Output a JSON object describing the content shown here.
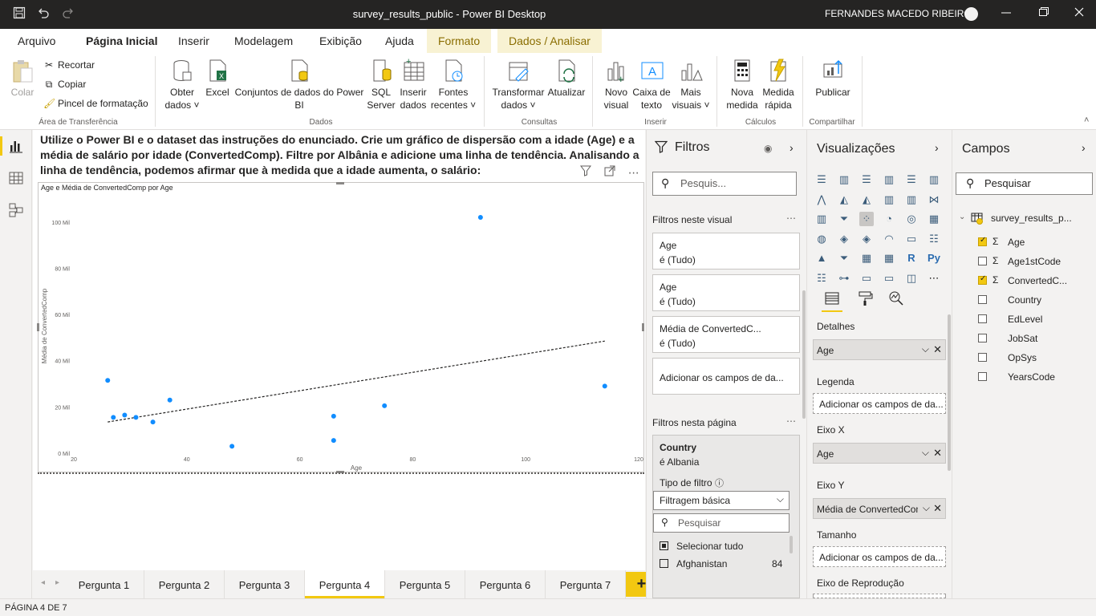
{
  "window": {
    "title": "survey_results_public - Power BI Desktop",
    "user": "FERNANDES MACEDO RIBEIRO"
  },
  "icons": {
    "save": "save-icon",
    "undo": "undo-icon",
    "redo": "redo-icon",
    "minimize": "minimize-icon",
    "maximize": "maximize-icon",
    "close": "close-icon"
  },
  "tabs": [
    "Arquivo",
    "Página Inicial",
    "Inserir",
    "Modelagem",
    "Exibição",
    "Ajuda",
    "Formato",
    "Dados / Analisar"
  ],
  "ribbon": {
    "clipboard": {
      "paste": "Colar",
      "cut": "Recortar",
      "copy": "Copiar",
      "painter": "Pincel de formatação",
      "group": "Área de Transferência"
    },
    "data": {
      "get1": "Obter",
      "get2": "dados",
      "excel": "Excel",
      "datasets1": "Conjuntos de dados do Power",
      "datasets2": "BI",
      "sql1": "SQL",
      "sql2": "Server",
      "enter1": "Inserir",
      "enter2": "dados",
      "sources1": "Fontes",
      "sources2": "recentes",
      "group": "Dados"
    },
    "queries": {
      "transform1": "Transformar",
      "transform2": "dados",
      "refresh": "Atualizar",
      "group": "Consultas"
    },
    "insert": {
      "visual1": "Novo",
      "visual2": "visual",
      "text1": "Caixa de",
      "text2": "texto",
      "more1": "Mais",
      "more2": "visuais",
      "group": "Inserir"
    },
    "calc": {
      "measure1": "Nova",
      "measure2": "medida",
      "quick1": "Medida",
      "quick2": "rápida",
      "group": "Cálculos"
    },
    "share": {
      "publish": "Publicar",
      "group": "Compartilhar"
    }
  },
  "question": "Utilize o Power BI e o dataset das instruções do enunciado. Crie um gráfico de dispersão com a idade (Age) e a média de salário por idade (ConvertedComp). Filtre por Albânia e adicione uma linha de tendência. Analisando a linha de tendência, podemos afirmar que à medida que a idade aumenta, o salário:",
  "chart_data": {
    "type": "scatter",
    "title": "Age e Média de ConvertedComp por Age",
    "xlabel": "Age",
    "ylabel": "Média de ConvertedComp",
    "xlim": [
      20,
      120
    ],
    "ylim": [
      0,
      110000
    ],
    "xticks": [
      20,
      40,
      60,
      80,
      100,
      120
    ],
    "yticks": [
      {
        "v": 0,
        "label": "0 Mil"
      },
      {
        "v": 20000,
        "label": "20 Mil"
      },
      {
        "v": 40000,
        "label": "40 Mil"
      },
      {
        "v": 60000,
        "label": "60 Mil"
      },
      {
        "v": 80000,
        "label": "80 Mil"
      },
      {
        "v": 100000,
        "label": "100 Mil"
      }
    ],
    "points": [
      {
        "x": 26,
        "y": 31500
      },
      {
        "x": 27,
        "y": 15500
      },
      {
        "x": 29,
        "y": 16500
      },
      {
        "x": 31,
        "y": 15500
      },
      {
        "x": 34,
        "y": 13500
      },
      {
        "x": 37,
        "y": 23000
      },
      {
        "x": 48,
        "y": 3000
      },
      {
        "x": 66,
        "y": 16000
      },
      {
        "x": 66,
        "y": 5500
      },
      {
        "x": 75,
        "y": 20500
      },
      {
        "x": 92,
        "y": 102000
      },
      {
        "x": 114,
        "y": 29000
      }
    ],
    "trendline": {
      "x0": 26,
      "y0": 13500,
      "x1": 114,
      "y1": 48500
    },
    "point_color": "#118dff"
  },
  "pages": [
    "Pergunta 1",
    "Pergunta 2",
    "Pergunta 3",
    "Pergunta 4",
    "Pergunta 5",
    "Pergunta 6",
    "Pergunta 7"
  ],
  "active_page": 3,
  "add_page": "+",
  "status": "PÁGINA 4 DE 7",
  "filters": {
    "title": "Filtros",
    "search_placeholder": "Pesquis...",
    "visual_section": "Filtros neste visual",
    "visual_cards": [
      {
        "field": "Age",
        "state": "é (Tudo)"
      },
      {
        "field": "Age",
        "state": "é (Tudo)"
      },
      {
        "field": "Média de ConvertedC...",
        "state": "é (Tudo)"
      }
    ],
    "add_fields": "Adicionar os campos de da...",
    "page_section": "Filtros nesta página",
    "page_card": {
      "field": "Country",
      "state": "é Albania"
    },
    "filter_type_label": "Tipo de filtro",
    "filter_type": "Filtragem básica",
    "search2": "Pesquisar",
    "select_all": "Selecionar tudo",
    "item": "Afghanistan",
    "item_count": "84"
  },
  "visualizations": {
    "title": "Visualizações",
    "details": "Detalhes",
    "details_value": "Age",
    "legend": "Legenda",
    "legend_placeholder": "Adicionar os campos de da...",
    "xaxis": "Eixo X",
    "xaxis_value": "Age",
    "yaxis": "Eixo Y",
    "yaxis_value": "Média de ConvertedComp",
    "size": "Tamanho",
    "size_placeholder": "Adicionar os campos de da...",
    "playback": "Eixo de Reprodução"
  },
  "fields": {
    "title": "Campos",
    "search_placeholder": "Pesquisar",
    "table": "survey_results_p...",
    "items": [
      {
        "name": "Age",
        "checked": true,
        "sigma": true
      },
      {
        "name": "Age1stCode",
        "checked": false,
        "sigma": true
      },
      {
        "name": "ConvertedC...",
        "checked": true,
        "sigma": true
      },
      {
        "name": "Country",
        "checked": false,
        "sigma": false
      },
      {
        "name": "EdLevel",
        "checked": false,
        "sigma": false
      },
      {
        "name": "JobSat",
        "checked": false,
        "sigma": false
      },
      {
        "name": "OpSys",
        "checked": false,
        "sigma": false
      },
      {
        "name": "YearsCode",
        "checked": false,
        "sigma": false
      }
    ]
  }
}
